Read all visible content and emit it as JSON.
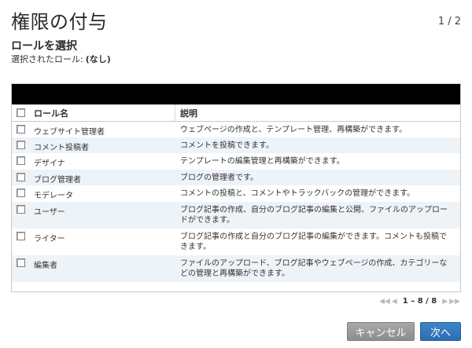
{
  "header": {
    "title": "権限の付与",
    "step": "1 / 2"
  },
  "section": {
    "subtitle": "ロールを選択",
    "selected_label": "選択されたロール:",
    "selected_value": "(なし)"
  },
  "table": {
    "columns": [
      "ロール名",
      "説明"
    ],
    "rows": [
      {
        "name": "ウェブサイト管理者",
        "desc": "ウェブページの作成と、テンプレート管理、再構築ができます。"
      },
      {
        "name": "コメント投稿者",
        "desc": "コメントを投稿できます。"
      },
      {
        "name": "デザイナ",
        "desc": "テンプレートの編集管理と再構築ができます。"
      },
      {
        "name": "ブログ管理者",
        "desc": "ブログの管理者です。"
      },
      {
        "name": "モデレータ",
        "desc": "コメントの投稿と、コメントやトラックバックの管理ができます。"
      },
      {
        "name": "ユーザー",
        "desc": "ブログ記事の作成、自分のブログ記事の編集と公開、ファイルのアップロードができます。"
      },
      {
        "name": "ライター",
        "desc": "ブログ記事の作成と自分のブログ記事の編集ができます。コメントも投稿できます。"
      },
      {
        "name": "編集者",
        "desc": "ファイルのアップロード、ブログ記事やウェブページの作成、カテゴリーなどの管理と再構築ができます。"
      }
    ]
  },
  "pager": {
    "first": "◀◀",
    "prev": "◀",
    "range": "1 – 8 / 8",
    "next": "▶",
    "last": "▶▶"
  },
  "buttons": {
    "cancel": "キャンセル",
    "next": "次へ"
  }
}
